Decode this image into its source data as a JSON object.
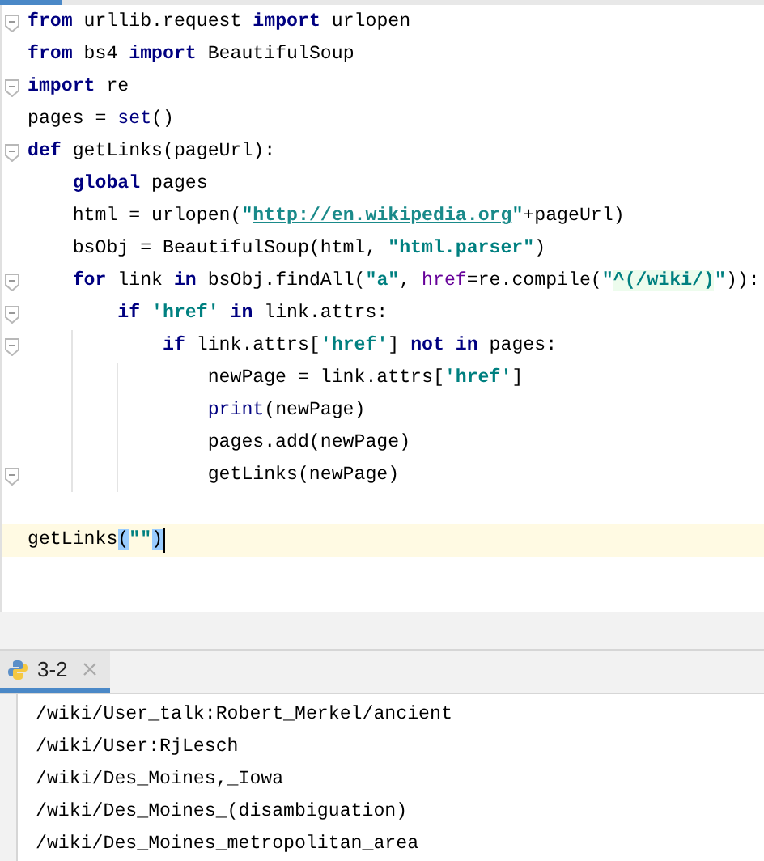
{
  "editor": {
    "lines": [
      {
        "fold": true,
        "current": false,
        "tokens": [
          {
            "kind": "keyword",
            "text": "from"
          },
          {
            "kind": "plain",
            "text": " urllib.request "
          },
          {
            "kind": "keyword",
            "text": "import"
          },
          {
            "kind": "plain",
            "text": " urlopen"
          }
        ]
      },
      {
        "fold": false,
        "current": false,
        "tokens": [
          {
            "kind": "keyword",
            "text": "from"
          },
          {
            "kind": "plain",
            "text": " bs4 "
          },
          {
            "kind": "keyword",
            "text": "import"
          },
          {
            "kind": "plain",
            "text": " BeautifulSoup"
          }
        ]
      },
      {
        "fold": true,
        "current": false,
        "tokens": [
          {
            "kind": "keyword",
            "text": "import"
          },
          {
            "kind": "plain",
            "text": " re"
          }
        ]
      },
      {
        "fold": false,
        "current": false,
        "tokens": [
          {
            "kind": "plain",
            "text": "pages = "
          },
          {
            "kind": "builtin",
            "text": "set"
          },
          {
            "kind": "plain",
            "text": "()"
          }
        ]
      },
      {
        "fold": true,
        "current": false,
        "tokens": [
          {
            "kind": "keyword",
            "text": "def"
          },
          {
            "kind": "plain",
            "text": " getLinks(pageUrl):"
          }
        ]
      },
      {
        "fold": false,
        "current": false,
        "tokens": [
          {
            "kind": "keyword",
            "text": "    global"
          },
          {
            "kind": "plain",
            "text": " pages"
          }
        ]
      },
      {
        "fold": false,
        "current": false,
        "tokens": [
          {
            "kind": "plain",
            "text": "    html = urlopen("
          },
          {
            "kind": "string",
            "text": "\""
          },
          {
            "kind": "url",
            "text": "http://en.wikipedia.org"
          },
          {
            "kind": "string",
            "text": "\""
          },
          {
            "kind": "plain",
            "text": "+pageUrl)"
          }
        ]
      },
      {
        "fold": false,
        "current": false,
        "tokens": [
          {
            "kind": "plain",
            "text": "    bsObj = BeautifulSoup(html, "
          },
          {
            "kind": "string",
            "text": "\"html.parser\""
          },
          {
            "kind": "plain",
            "text": ")"
          }
        ]
      },
      {
        "fold": true,
        "current": false,
        "tokens": [
          {
            "kind": "keyword",
            "text": "    for"
          },
          {
            "kind": "plain",
            "text": " link "
          },
          {
            "kind": "keyword",
            "text": "in"
          },
          {
            "kind": "plain",
            "text": " bsObj.findAll("
          },
          {
            "kind": "string",
            "text": "\"a\""
          },
          {
            "kind": "plain",
            "text": ", "
          },
          {
            "kind": "kwarg",
            "text": "href"
          },
          {
            "kind": "plain",
            "text": "=re.compile("
          },
          {
            "kind": "string",
            "text": "\""
          },
          {
            "kind": "regex",
            "text": "^(/wiki/)"
          },
          {
            "kind": "string",
            "text": "\""
          },
          {
            "kind": "plain",
            "text": ")):"
          }
        ]
      },
      {
        "fold": true,
        "current": false,
        "tokens": [
          {
            "kind": "keyword",
            "text": "        if "
          },
          {
            "kind": "string",
            "text": "'href'"
          },
          {
            "kind": "keyword",
            "text": " in"
          },
          {
            "kind": "plain",
            "text": " link.attrs:"
          }
        ]
      },
      {
        "fold": true,
        "current": false,
        "tokens": [
          {
            "kind": "keyword",
            "text": "            if"
          },
          {
            "kind": "plain",
            "text": " link.attrs["
          },
          {
            "kind": "string",
            "text": "'href'"
          },
          {
            "kind": "plain",
            "text": "] "
          },
          {
            "kind": "keyword",
            "text": "not in"
          },
          {
            "kind": "plain",
            "text": " pages:"
          }
        ]
      },
      {
        "fold": false,
        "current": false,
        "tokens": [
          {
            "kind": "plain",
            "text": "                newPage = link.attrs["
          },
          {
            "kind": "string",
            "text": "'href'"
          },
          {
            "kind": "plain",
            "text": "]"
          }
        ]
      },
      {
        "fold": false,
        "current": false,
        "tokens": [
          {
            "kind": "builtin",
            "text": "                print"
          },
          {
            "kind": "plain",
            "text": "(newPage)"
          }
        ]
      },
      {
        "fold": false,
        "current": false,
        "tokens": [
          {
            "kind": "plain",
            "text": "                pages.add(newPage)"
          }
        ]
      },
      {
        "fold": true,
        "current": false,
        "tokens": [
          {
            "kind": "plain",
            "text": "                getLinks(newPage)"
          }
        ]
      },
      {
        "fold": false,
        "current": false
      },
      {
        "fold": false,
        "current": true,
        "tokens": [
          {
            "kind": "plain",
            "text": "getLinks"
          },
          {
            "kind": "match",
            "text": "("
          },
          {
            "kind": "string",
            "text": "\"\""
          },
          {
            "kind": "match",
            "text": ")"
          }
        ]
      }
    ]
  },
  "run_panel": {
    "tabs": [
      {
        "label": "3-2",
        "selected": true
      }
    ],
    "output": [
      "/wiki/User_talk:Robert_Merkel/ancient",
      "/wiki/User:RjLesch",
      "/wiki/Des_Moines,_Iowa",
      "/wiki/Des_Moines_(disambiguation)",
      "/wiki/Des_Moines_metropolitan_area"
    ]
  }
}
